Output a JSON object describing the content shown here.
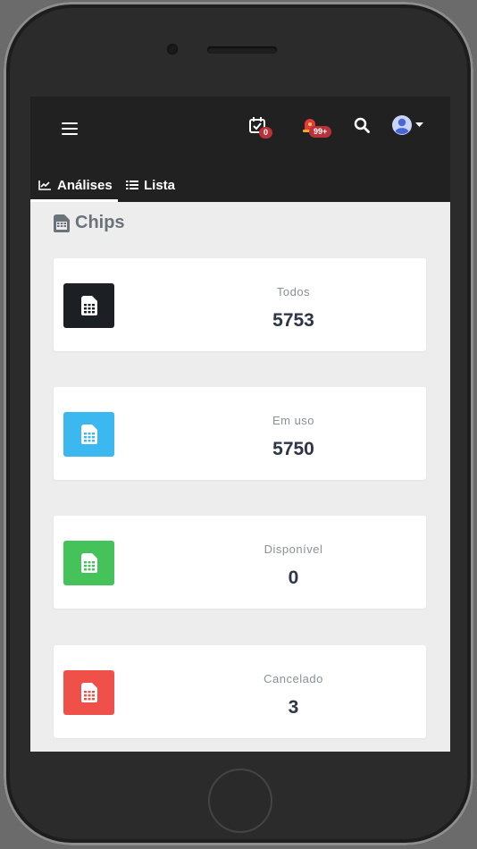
{
  "header": {
    "calendar_badge": "0",
    "notifications_badge": "99+"
  },
  "tabs": [
    {
      "label": "Análises",
      "icon": "chart-line-icon",
      "active": true
    },
    {
      "label": "Lista",
      "icon": "list-icon",
      "active": false
    }
  ],
  "section": {
    "title": "Chips",
    "icon": "sim-card-icon"
  },
  "cards": [
    {
      "label": "Todos",
      "value": "5753",
      "color": "#1c1f24"
    },
    {
      "label": "Em uso",
      "value": "5750",
      "color": "#3cb8f0"
    },
    {
      "label": "Disponível",
      "value": "0",
      "color": "#46c25a"
    },
    {
      "label": "Cancelado",
      "value": "3",
      "color": "#f0504a"
    }
  ]
}
